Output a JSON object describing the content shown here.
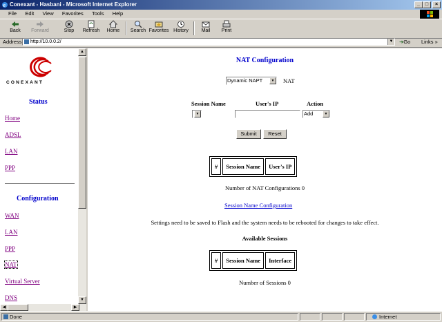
{
  "window": {
    "title": "Conexant - Hasbani - Microsoft Internet Explorer"
  },
  "menu": [
    "File",
    "Edit",
    "View",
    "Favorites",
    "Tools",
    "Help"
  ],
  "toolbar": [
    {
      "label": "Back"
    },
    {
      "label": "Forward"
    },
    {
      "label": "Stop"
    },
    {
      "label": "Refresh"
    },
    {
      "label": "Home"
    },
    {
      "label": "Search"
    },
    {
      "label": "Favorites"
    },
    {
      "label": "History"
    },
    {
      "label": "Mail"
    },
    {
      "label": "Print"
    }
  ],
  "address": {
    "label": "Address",
    "value": "http://10.0.0.2/",
    "go": "Go",
    "links": "Links"
  },
  "sidebar": {
    "brand": "CONEXANT",
    "status_heading": "Status",
    "status_links": [
      "Home",
      "ADSL",
      "LAN",
      "PPP"
    ],
    "config_heading": "Configuration",
    "config_links": [
      "WAN",
      "LAN",
      "PPP",
      "NAT",
      "Virtual Server",
      "DNS"
    ]
  },
  "main": {
    "title": "NAT Configuration",
    "mode_select": "Dynamic NAPT",
    "mode_label": "NAT",
    "col_session": "Session Name",
    "col_userip": "User's IP",
    "col_action": "Action",
    "action_select": "Add",
    "submit": "Submit",
    "reset": "Reset",
    "nat_table_headers": [
      "#",
      "Session Name",
      "User's IP"
    ],
    "nat_count": "Number of NAT Configurations 0",
    "session_link": "Session Name Configuration",
    "notice": "Settings need to be saved to Flash and the system needs to be rebooted for changes to take effect.",
    "available_heading": "Available Sessions",
    "session_table_headers": [
      "#",
      "Session Name",
      "Interface"
    ],
    "session_count": "Number of Sessions 0"
  },
  "statusbar": {
    "text": "Done",
    "zone": "Internet"
  }
}
